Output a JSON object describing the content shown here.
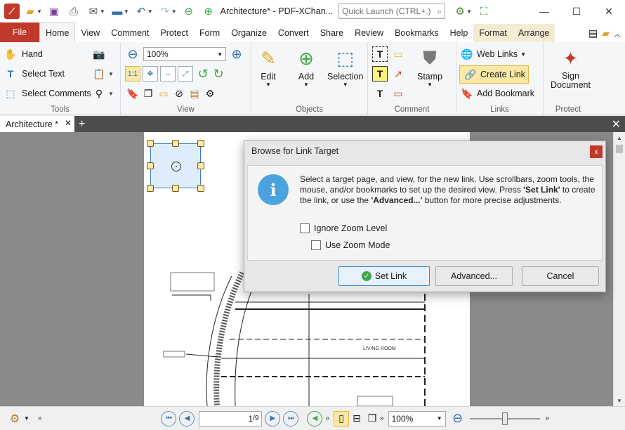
{
  "titlebar": {
    "title": "Architecture* - PDF-XChan...",
    "quick_launch_placeholder": "Quick Launch (CTRL+.)",
    "minimize": "—",
    "maximize": "☐",
    "close": "✕"
  },
  "tabs": {
    "file": "File",
    "items": [
      "Home",
      "View",
      "Comment",
      "Protect",
      "Form",
      "Organize",
      "Convert",
      "Share",
      "Review",
      "Bookmarks",
      "Help"
    ],
    "contextual": [
      "Format",
      "Arrange"
    ],
    "active": "Home"
  },
  "ribbon": {
    "tools": {
      "label": "Tools",
      "hand": "Hand",
      "select_text": "Select Text",
      "select_comments": "Select Comments"
    },
    "view": {
      "label": "View",
      "zoom_value": "100%"
    },
    "objects": {
      "label": "Objects",
      "edit": "Edit",
      "add": "Add",
      "selection": "Selection"
    },
    "comment": {
      "label": "Comment",
      "stamp": "Stamp"
    },
    "links": {
      "label": "Links",
      "web_links": "Web Links",
      "create_link": "Create Link",
      "add_bookmark": "Add Bookmark"
    },
    "protect": {
      "label": "Protect",
      "sign_document_line1": "Sign",
      "sign_document_line2": "Document"
    }
  },
  "doc_tabs": {
    "active_tab": "Architecture *",
    "close": "✕",
    "new_tab": "+"
  },
  "drawing": {
    "living_room": "LIVING ROOM"
  },
  "dialog": {
    "title": "Browse for Link Target",
    "close": "x",
    "message_part1": "Select a target page, and view, for the new link. Use scrollbars, zoom tools, the mouse, and/or bookmarks to set up the desired view. Press ",
    "message_bold1": "'Set Link'",
    "message_part2": " to create the link, or use the ",
    "message_bold2": "'Advanced...'",
    "message_part3": " button for more precise adjustments.",
    "ignore_zoom": "Ignore Zoom Level",
    "use_zoom_mode": "Use Zoom Mode",
    "set_link": "Set Link",
    "advanced": "Advanced...",
    "cancel": "Cancel"
  },
  "statusbar": {
    "page_current": "1",
    "page_total": "/9",
    "zoom": "100%"
  }
}
